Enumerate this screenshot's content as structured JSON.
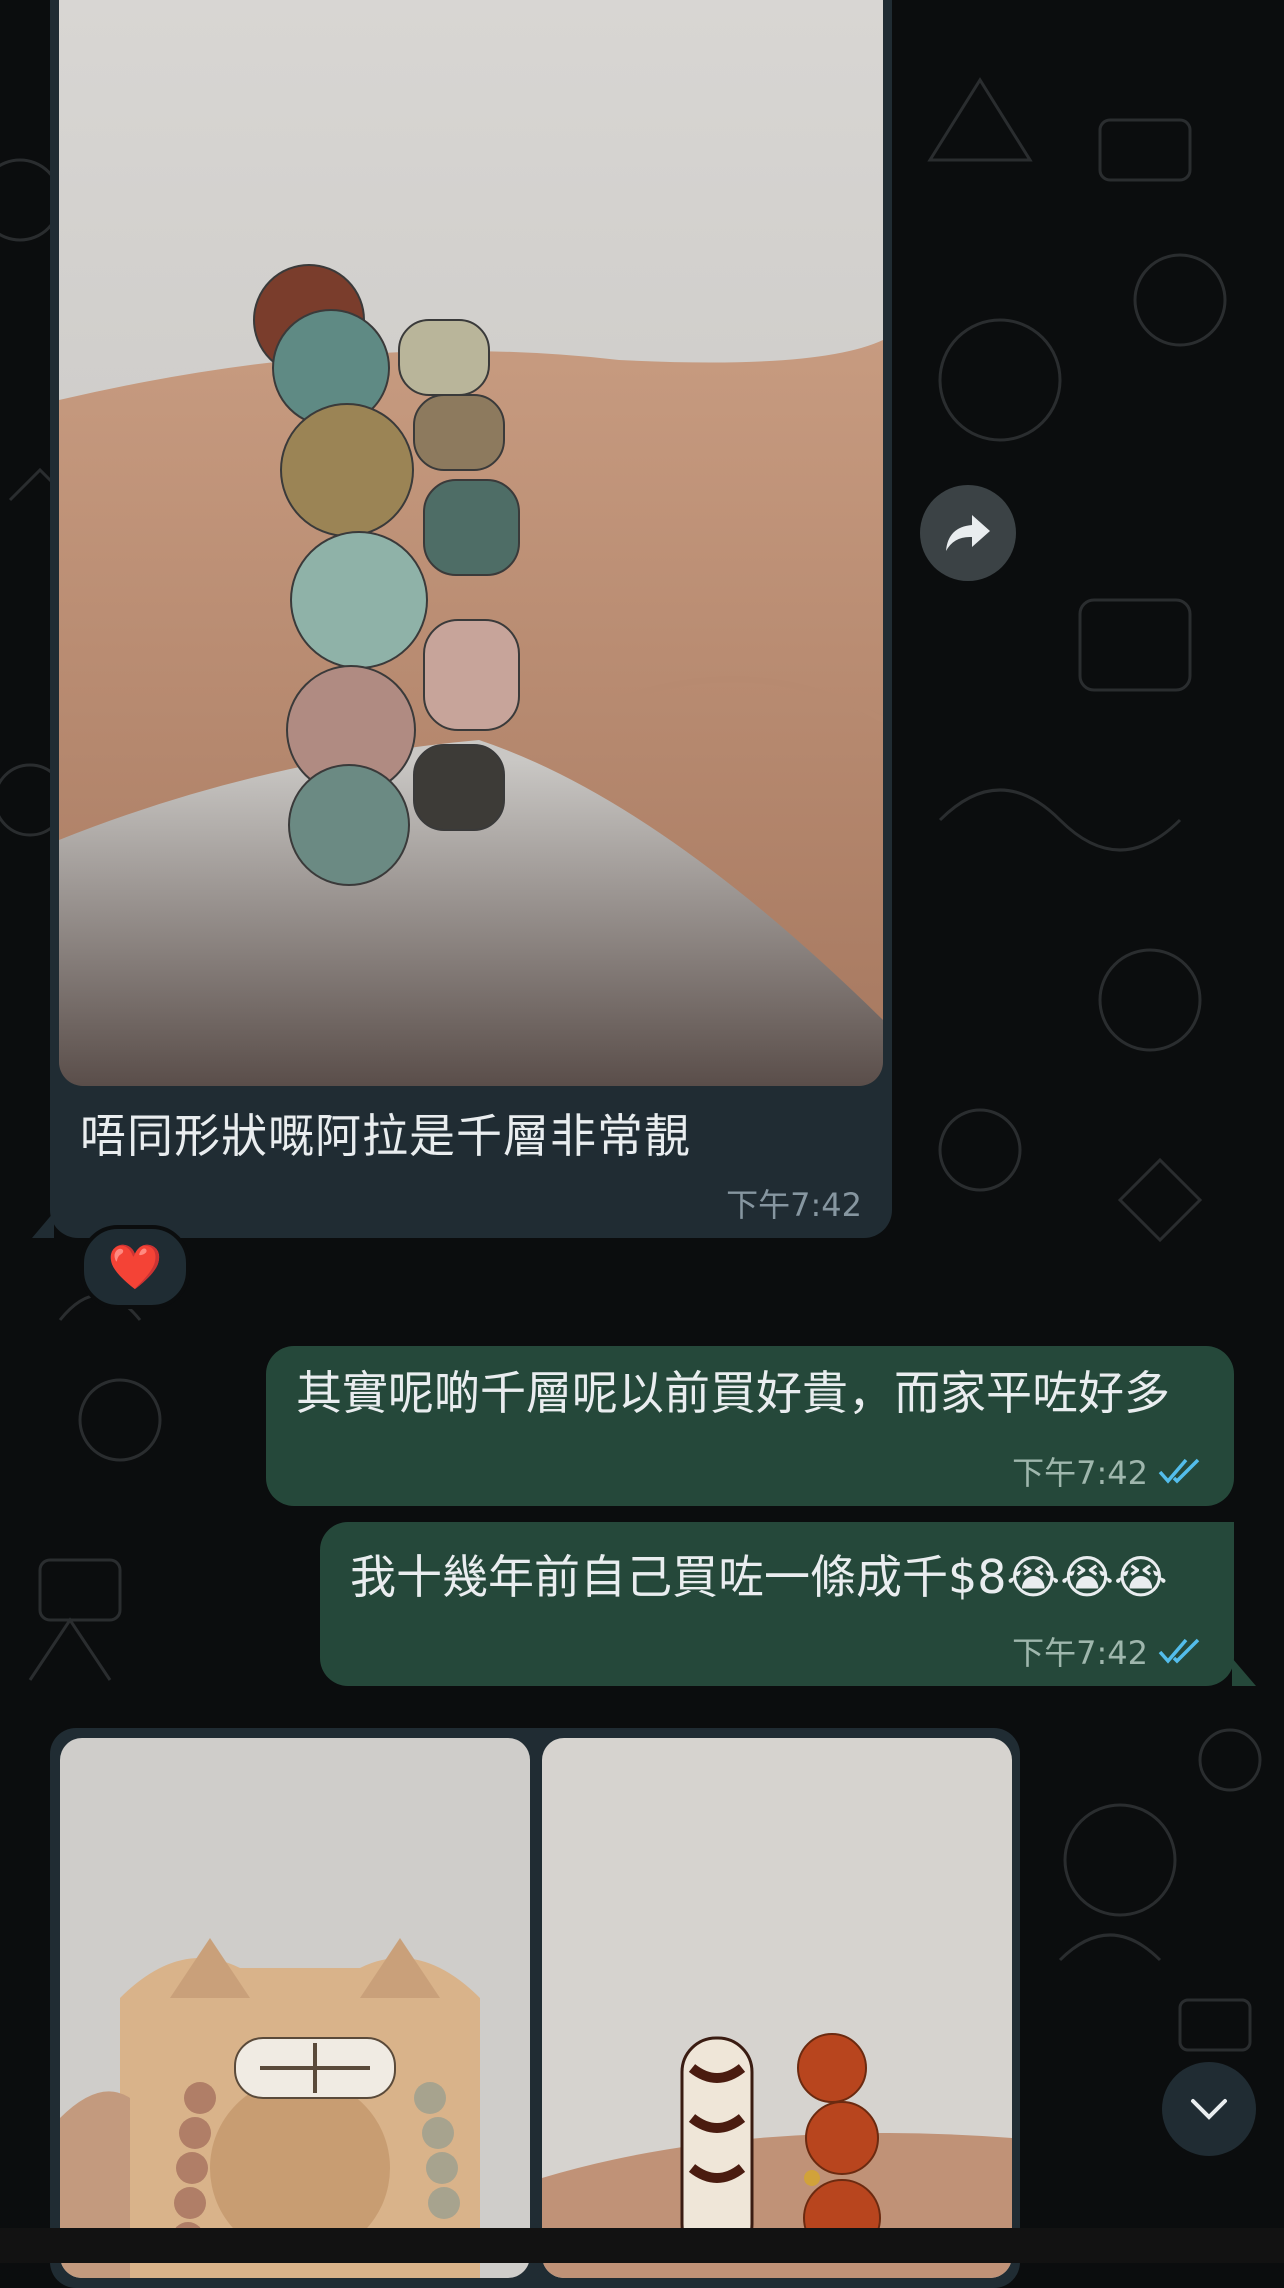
{
  "colors": {
    "chat_background": "#0b0d0e",
    "incoming_bubble": "#202c33",
    "outgoing_bubble": "#25483a",
    "read_ticks": "#53bdeb",
    "timestamp": "#8696a0"
  },
  "messages": {
    "incoming_image": {
      "caption": "唔同形狀嘅阿拉是千層非常靚",
      "time": "下午7:42",
      "reaction": "❤️"
    },
    "outgoing": [
      {
        "text": "其實呢啲千層呢以前買好貴，而家平咗好多",
        "time": "下午7:42",
        "status_icon": "double-check-icon"
      },
      {
        "text": "我十幾年前自己買咗一條成千$8😭😭😭",
        "time": "下午7:42",
        "status_icon": "double-check-icon"
      }
    ]
  },
  "controls": {
    "forward_icon": "forward-arrow-icon",
    "scroll_down_icon": "chevron-down-icon"
  }
}
